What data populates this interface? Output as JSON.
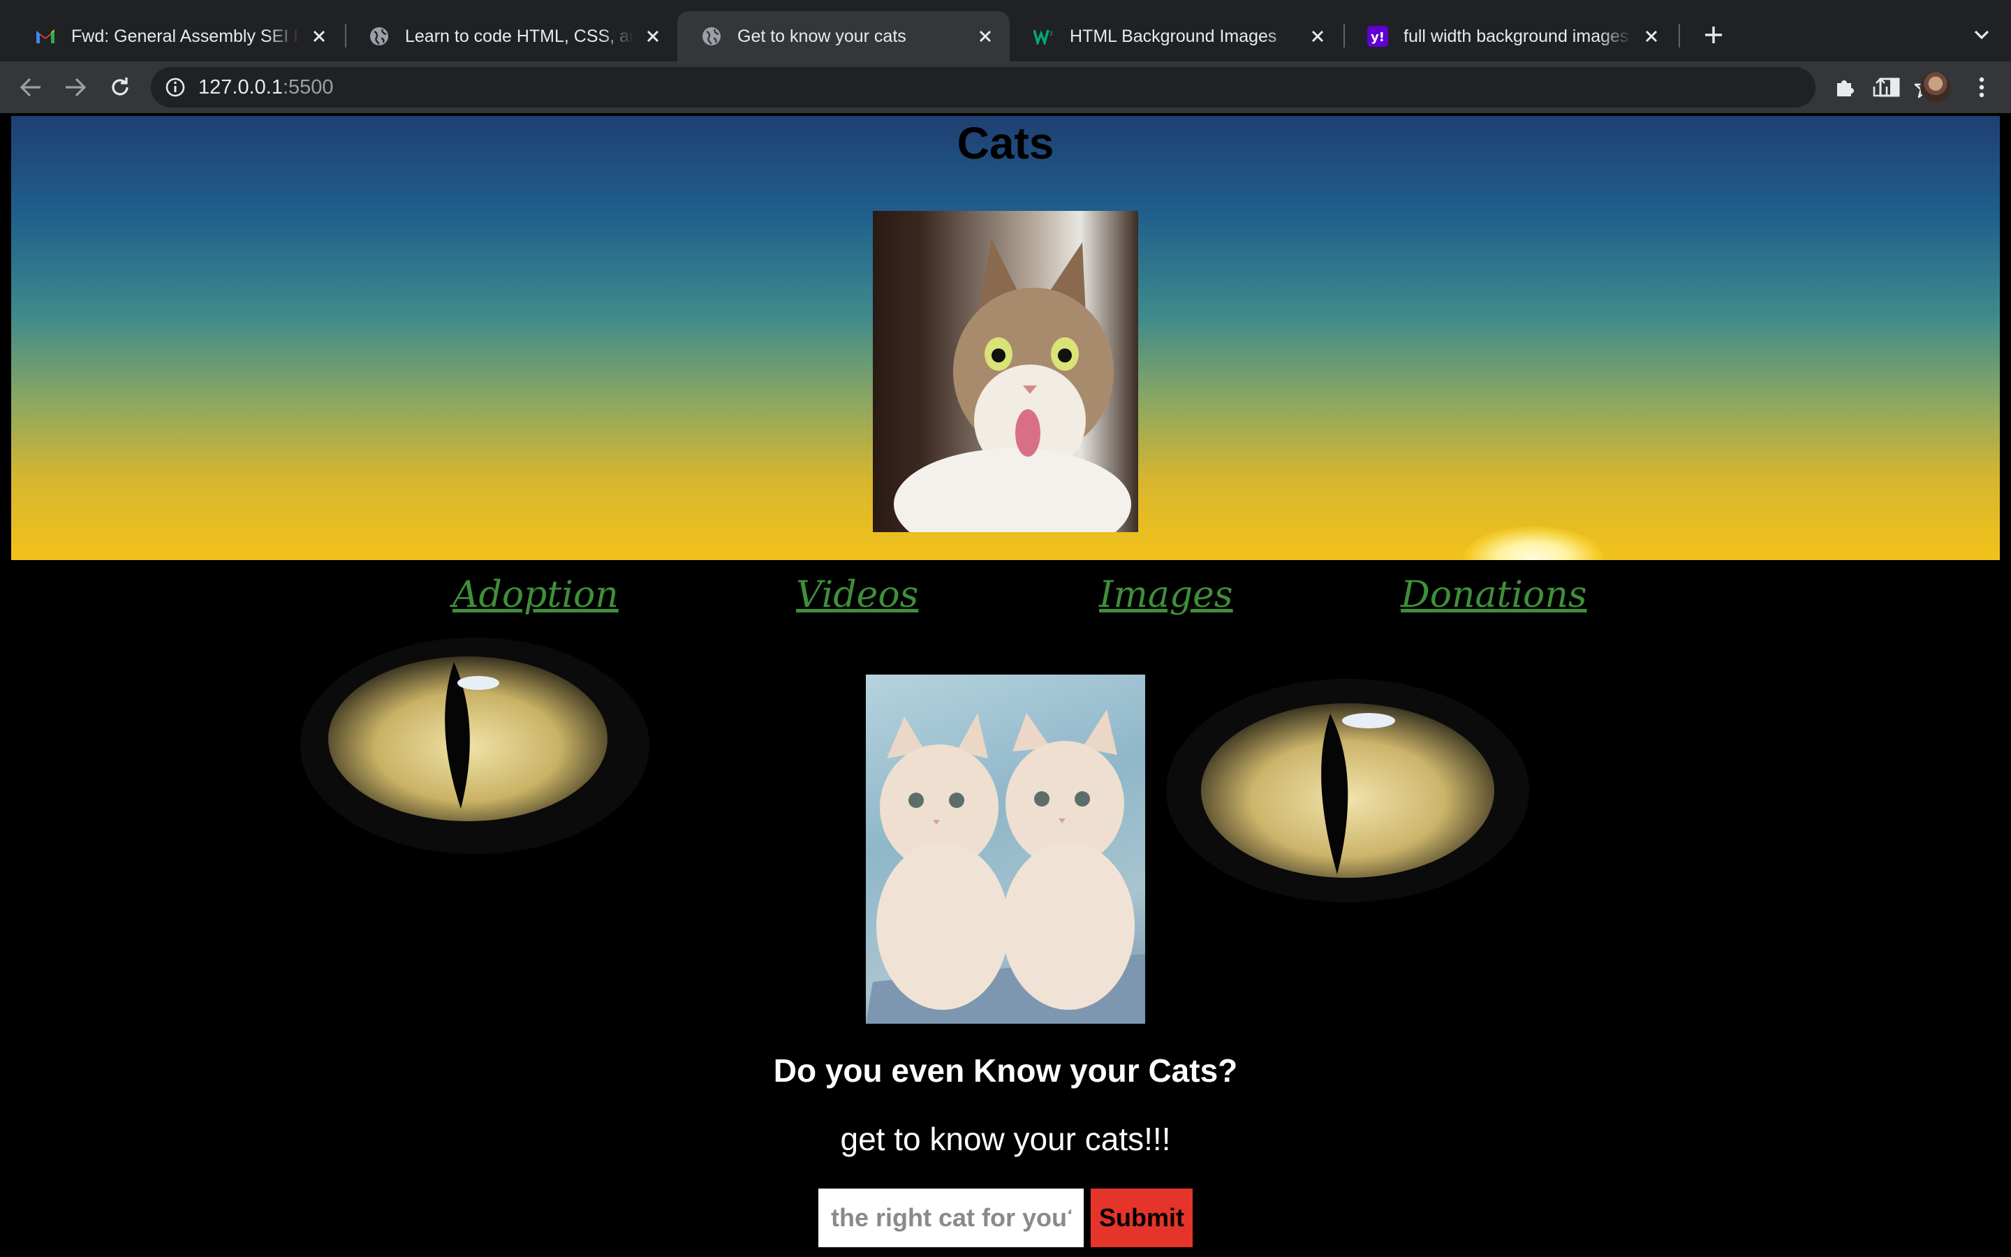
{
  "browser": {
    "tabs": [
      {
        "title": "Fwd: General Assembly SEI Inte",
        "favicon": "gmail-icon",
        "active": false
      },
      {
        "title": "Learn to code HTML, CSS, and",
        "favicon": "globe-icon",
        "active": false
      },
      {
        "title": "Get to know your cats",
        "favicon": "globe-icon",
        "active": true
      },
      {
        "title": "HTML Background Images",
        "favicon": "w3schools-icon",
        "active": false
      },
      {
        "title": "full width background images -",
        "favicon": "yahoo-icon",
        "active": false
      }
    ],
    "address": {
      "host": "127.0.0.1",
      "port": ":5500"
    }
  },
  "page": {
    "title": "Cats",
    "nav": [
      "Adoption",
      "Videos",
      "Images",
      "Donations"
    ],
    "question": "Do you even Know your Cats?",
    "tagline": "get to know your cats!!!",
    "input_placeholder": "the right cat for you?",
    "submit_label": "Submit"
  },
  "colors": {
    "nav_link": "#3f8f3a",
    "submit": "#e5342a",
    "chrome_bg": "#202124",
    "toolbar_bg": "#35363a"
  }
}
